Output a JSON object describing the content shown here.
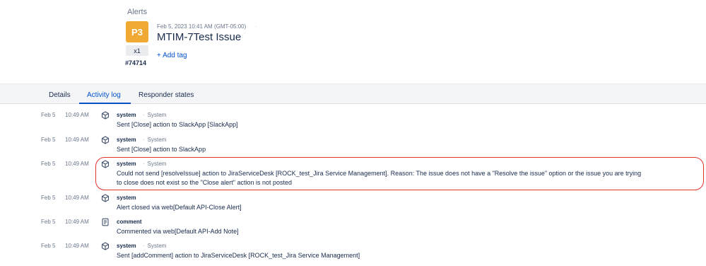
{
  "header": {
    "breadcrumb": "Alerts",
    "priority": "P3",
    "count": "x1",
    "alert_id": "#74714",
    "timestamp": "Feb 5, 2023 10:41 AM (GMT-05:00)",
    "separator": "·",
    "title": "MTIM-7Test Issue",
    "add_tag": "+ Add tag"
  },
  "tabs": [
    {
      "label": "Details",
      "active": false
    },
    {
      "label": "Activity log",
      "active": true
    },
    {
      "label": "Responder states",
      "active": false
    }
  ],
  "log": [
    {
      "date": "Feb 5",
      "time": "10:49 AM",
      "icon": "cube-icon",
      "actor": "system",
      "role": "System",
      "lines": [
        "Sent [Close] action to SlackApp [SlackApp]"
      ]
    },
    {
      "date": "Feb 5",
      "time": "10:49 AM",
      "icon": "cube-icon",
      "actor": "system",
      "role": "System",
      "lines": [
        "Sent [Close] action to SlackApp"
      ]
    },
    {
      "date": "Feb 5",
      "time": "10:49 AM",
      "icon": "cube-icon",
      "actor": "system",
      "role": "System",
      "lines": [
        "Could not send [resolveIssue] action to JiraServiceDesk [ROCK_test_Jira Service Management]. Reason: The issue does not have a \"Resolve the issue\" option or the issue you are trying",
        "to close does not exist so the \"Close alert\" action is not posted"
      ]
    },
    {
      "date": "Feb 5",
      "time": "10:49 AM",
      "icon": "cube-icon",
      "actor": "system",
      "role": "",
      "lines": [
        "Alert closed via web[Default API-Close Alert]"
      ]
    },
    {
      "date": "Feb 5",
      "time": "10:49 AM",
      "icon": "note-icon",
      "actor": "comment",
      "role": "",
      "lines": [
        "Commented via web[Default API-Add Note]"
      ]
    },
    {
      "date": "Feb 5",
      "time": "10:49 AM",
      "icon": "cube-icon",
      "actor": "system",
      "role": "System",
      "lines": [
        "Sent [addComment] action to JiraServiceDesk [ROCK_test_Jira Service Management]"
      ]
    }
  ],
  "colors": {
    "priority": "#f0a932",
    "link": "#0052cc",
    "highlight": "#e5312b"
  }
}
